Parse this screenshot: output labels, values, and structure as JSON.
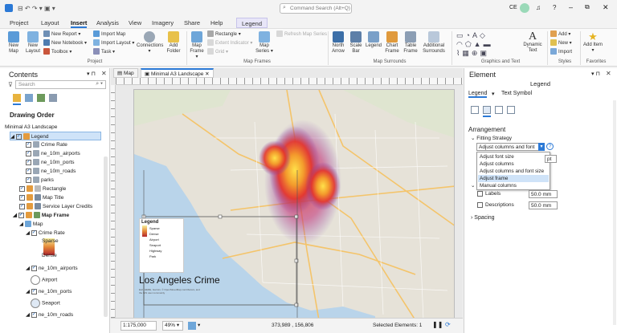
{
  "titlebar": {
    "search_placeholder": "Command Search (Alt+Q)",
    "user_initials": "CE"
  },
  "ribbon_tabs": [
    "Project",
    "Layout",
    "Insert",
    "Analysis",
    "View",
    "Imagery",
    "Share",
    "Help",
    "Legend"
  ],
  "ribbon": {
    "project_group": {
      "label": "Project",
      "new_map": "New Map",
      "new_layout": "New Layout",
      "new_report": "New Report",
      "new_notebook": "New Notebook",
      "toolbox": "Toolbox",
      "import_map": "Import Map",
      "import_layout": "Import Layout",
      "task": "Task",
      "connections": "Connections",
      "add_folder": "Add Folder"
    },
    "map_frames_group": {
      "label": "Map Frames",
      "map_frame": "Map Frame",
      "rectangle": "Rectangle",
      "extent_indicator": "Extent Indicator",
      "grid": "Grid",
      "map_series": "Map Series",
      "refresh_map_series": "Refresh Map Series"
    },
    "map_surrounds_group": {
      "label": "Map Surrounds",
      "north_arrow": "North Arrow",
      "scale_bar": "Scale Bar",
      "legend": "Legend",
      "chart_frame": "Chart Frame",
      "table_frame": "Table Frame",
      "additional_surrounds": "Additional Surrounds"
    },
    "graphics_group": {
      "label": "Graphics and Text",
      "dynamic_text": "Dynamic Text"
    },
    "styles_group": {
      "label": "Styles",
      "add": "Add",
      "new": "New",
      "import": "Import"
    },
    "favorites_group": {
      "label": "Favorites",
      "add_item": "Add Item"
    }
  },
  "contents": {
    "title": "Contents",
    "search_placeholder": "Search",
    "drawing_order": "Drawing Order",
    "items": [
      {
        "label": "Minimal A3 Landscape",
        "level": 0
      },
      {
        "label": "Legend",
        "level": 1
      },
      {
        "label": "Crime Rate",
        "level": 2
      },
      {
        "label": "ne_10m_airports",
        "level": 2
      },
      {
        "label": "ne_10m_ports",
        "level": 2
      },
      {
        "label": "ne_10m_roads",
        "level": 2
      },
      {
        "label": "parks",
        "level": 2
      },
      {
        "label": "Rectangle",
        "level": 1
      },
      {
        "label": "Map Title",
        "level": 1
      },
      {
        "label": "Service Layer Credits",
        "level": 1
      },
      {
        "label": "Map Frame",
        "level": 1
      },
      {
        "label": "Map",
        "level": 2
      },
      {
        "label": "Crime Rate",
        "level": 3
      },
      {
        "label": "Sparse",
        "level": 4
      },
      {
        "label": "Dense",
        "level": 4
      },
      {
        "label": "ne_10m_airports",
        "level": 3
      },
      {
        "label": "Airport",
        "level": 4
      },
      {
        "label": "ne_10m_ports",
        "level": 3
      },
      {
        "label": "Seaport",
        "level": 4
      },
      {
        "label": "ne_10m_roads",
        "level": 3
      }
    ]
  },
  "view_tabs": [
    "Map",
    "Minimal A3 Landscape"
  ],
  "layout": {
    "map_title": "Los Angeles Crime",
    "legend_title": "Legend",
    "legend_items": [
      "Sparse",
      "Dense",
      "Airport",
      "Seaport",
      "Highway",
      "Park"
    ],
    "credits": "Esri, HERE, Garmin, © OpenStreetMap contributors, and the GIS user community"
  },
  "status": {
    "scale": "1:175,000",
    "zoom": "49%",
    "coords": "373,989 , 156,806",
    "selected": "Selected Elements: 1"
  },
  "element_pane": {
    "title": "Element",
    "subtitle": "Legend",
    "tab_legend": "Legend",
    "tab_text_symbol": "Text Symbol",
    "arrangement": "Arrangement",
    "fitting_strategy": "Fitting Strategy",
    "fitting_value": "Adjust columns and font size",
    "options": [
      "Adjust font size",
      "Adjust columns",
      "Adjust columns and font size",
      "Adjust frame",
      "Manual columns"
    ],
    "selected_option_index": 3,
    "pt_label": "pt",
    "labels_label": "Labels",
    "labels_value": "50.0 mm",
    "descriptions_label": "Descriptions",
    "descriptions_value": "50.0 mm",
    "spacing": "Spacing"
  },
  "colors": {
    "accent": "#2b79d6",
    "heat_hot": "#ffe14a",
    "heat_mid": "#e4352b",
    "heat_cool": "#7a3fb0",
    "water": "#b9d4ea",
    "land": "#e6e2d8"
  }
}
